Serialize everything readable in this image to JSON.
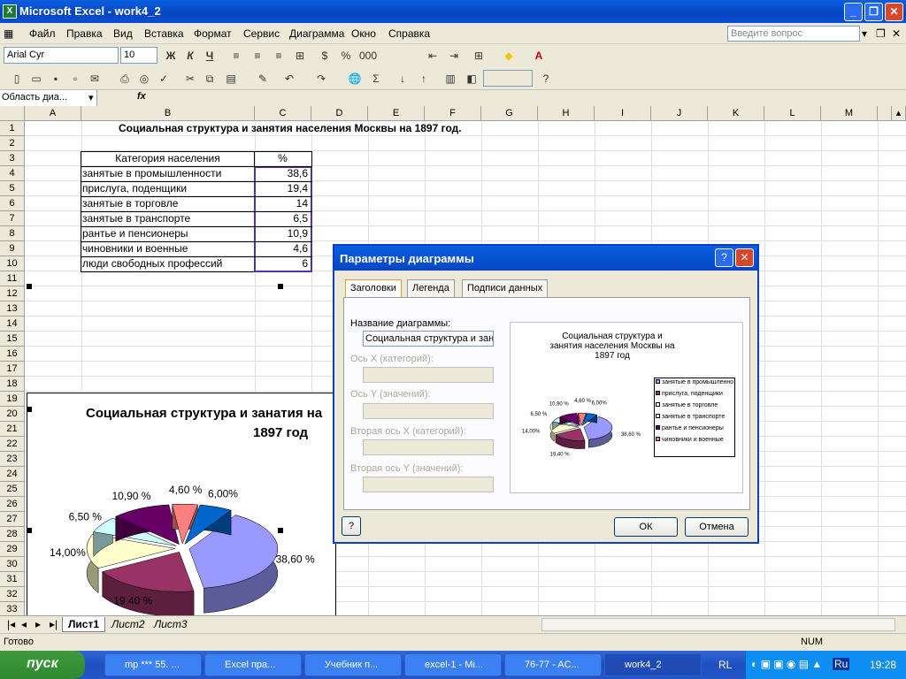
{
  "window": {
    "title": "Microsoft Excel - work4_2"
  },
  "menu": {
    "items": [
      "Файл",
      "Правка",
      "Вид",
      "Вставка",
      "Формат",
      "Сервис",
      "Диаграмма",
      "Окно",
      "Справка"
    ],
    "help_placeholder": "Введите вопрос"
  },
  "toolbar": {
    "font": "Arial Cyr",
    "size": "10",
    "bold": "Ж",
    "italic": "К",
    "underline": "Ч",
    "sigma": "Σ",
    "fx": "fx"
  },
  "namebox": {
    "value": "Область диа..."
  },
  "columns": [
    "A",
    "B",
    "C",
    "D",
    "E",
    "F",
    "G",
    "H",
    "I",
    "J",
    "K",
    "L",
    "M"
  ],
  "rows": [
    "1",
    "2",
    "3",
    "4",
    "5",
    "6",
    "7",
    "8",
    "9",
    "10",
    "11",
    "12",
    "13",
    "14",
    "15",
    "16",
    "17",
    "18",
    "19",
    "20",
    "21",
    "22",
    "23",
    "24",
    "25",
    "26",
    "27",
    "28",
    "29",
    "30",
    "31",
    "32",
    "33"
  ],
  "sheet": {
    "title": "Социальная структура  и занятия населения Москвы на 1897 год.",
    "header_category": "Категория населения",
    "header_percent": "%",
    "table": [
      {
        "category": "занятые в промышленности",
        "value": "38,6"
      },
      {
        "category": "прислуга, поденщики",
        "value": "19,4"
      },
      {
        "category": "занятые в торговле",
        "value": "14"
      },
      {
        "category": "занятые в транспорте",
        "value": "6,5"
      },
      {
        "category": "рантье и пенсионеры",
        "value": "10,9"
      },
      {
        "category": "чиновники и военные",
        "value": "4,6"
      },
      {
        "category": "люди свободных профессий",
        "value": "6"
      }
    ]
  },
  "chart_data": {
    "type": "pie",
    "title": "Социальная структура и занятия населения Москвы на 1897 год",
    "categories": [
      "занятые в промышленности",
      "прислуга, поденщики",
      "занятые в торговле",
      "занятые в транспорте",
      "рантье и пенсионеры",
      "чиновники и военные",
      "люди свободных профессий"
    ],
    "values": [
      38.6,
      19.4,
      14,
      6.5,
      10.9,
      4.6,
      6
    ],
    "data_labels": [
      "38,60 %",
      "19,40 %",
      "14,00%",
      "6,50 %",
      "10,90 %",
      "4,60 %",
      "6,00%"
    ],
    "colors": [
      "#9999ff",
      "#993366",
      "#ffffcc",
      "#ccffff",
      "#660066",
      "#ff8080",
      "#0066cc"
    ],
    "legend": "right"
  },
  "chart_labels": {
    "title_line1": "Социальная структура и занатия на",
    "title_line2": "1897 год"
  },
  "dialog": {
    "title": "Параметры диаграммы",
    "tabs": [
      "Заголовки",
      "Легенда",
      "Подписи данных"
    ],
    "chart_title_label": "Название диаграммы:",
    "chart_title_value": "Социальная структура и зан",
    "x_axis_label": "Ось X (категорий):",
    "y_axis_label": "Ось Y (значений):",
    "x2_axis_label": "Вторая ось X (категорий):",
    "y2_axis_label": "Вторая ось Y (значений):",
    "preview_title": "Социальная структура и занятия населения Москвы на 1897 год",
    "legend_items": [
      "занятые в промышленности",
      "прислуга, поденщики",
      "занятые в торговле",
      "занятые в транспорте",
      "рантье и пенсионеры",
      "чиновники и военные"
    ],
    "ok": "ОК",
    "cancel": "Отмена"
  },
  "tabs": {
    "sheets": [
      "Лист1",
      "Лист2",
      "Лист3"
    ]
  },
  "status": {
    "ready": "Готово",
    "num": "NUM"
  },
  "taskbar": {
    "start": "пуск",
    "tasks": [
      "mp *** 55. ...",
      "Excel   пра...",
      "Учебник п...",
      "excel-1 - Mi...",
      "76-77 - AC...",
      "work4_2"
    ],
    "lang": "RL",
    "tray_lang": "Ru",
    "time": "19:28"
  }
}
